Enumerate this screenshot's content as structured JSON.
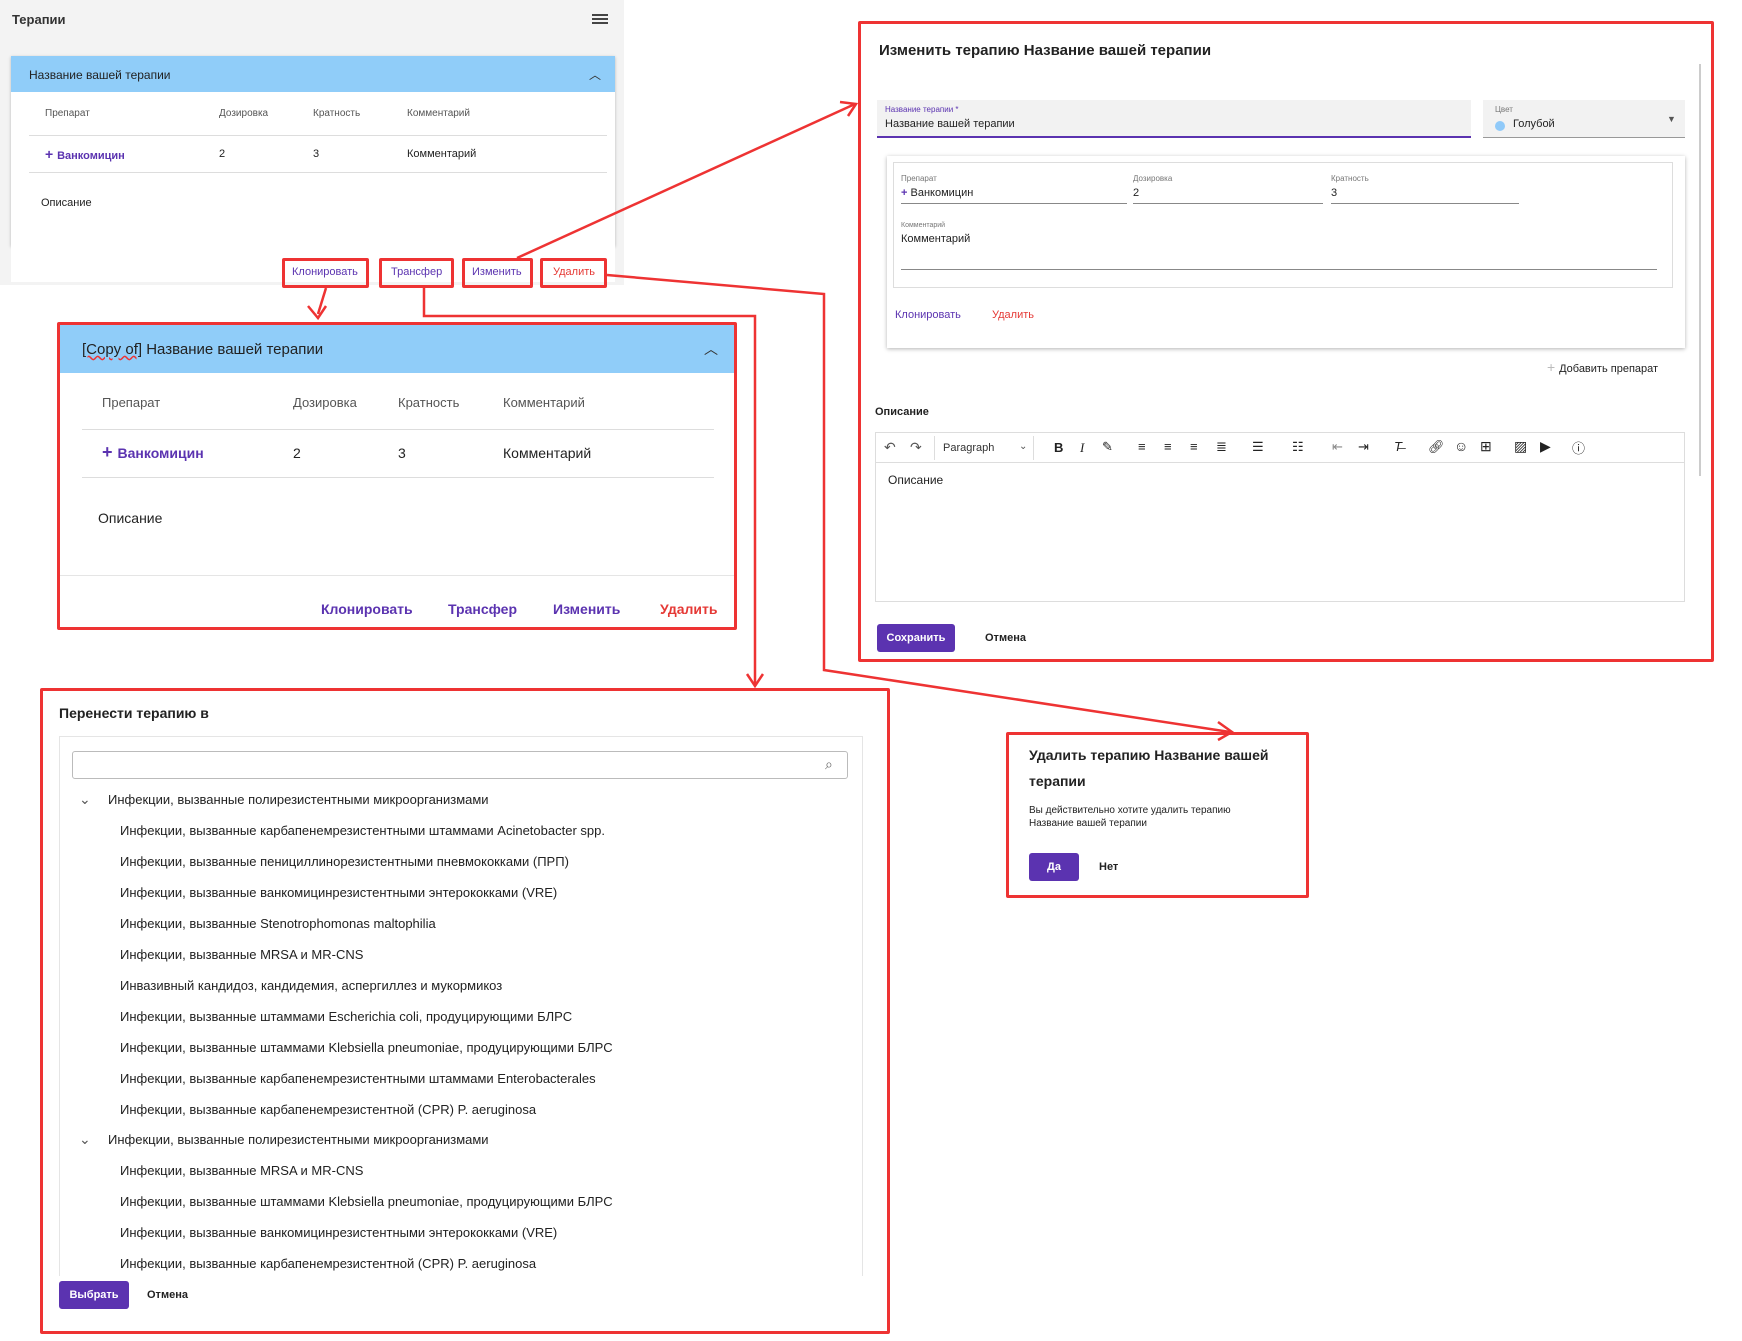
{
  "panel": {
    "title": "Терапии",
    "card_title": "Название вашей терапии",
    "columns": [
      "Препарат",
      "Дозировка",
      "Кратность",
      "Комментарий"
    ],
    "row": {
      "drug": "Ванкомицин",
      "dosage": "2",
      "frequency": "3",
      "comment": "Комментарий"
    },
    "description": "Описание",
    "actions": {
      "clone": "Клонировать",
      "transfer": "Трансфер",
      "edit": "Изменить",
      "delete": "Удалить"
    }
  },
  "clone_card": {
    "prefix": "[Copy of]",
    "title": "Название вашей терапии",
    "columns": [
      "Препарат",
      "Дозировка",
      "Кратность",
      "Комментарий"
    ],
    "row": {
      "drug": "Ванкомицин",
      "dosage": "2",
      "frequency": "3",
      "comment": "Комментарий"
    },
    "description": "Описание",
    "actions": {
      "clone": "Клонировать",
      "transfer": "Трансфер",
      "edit": "Изменить",
      "delete": "Удалить"
    }
  },
  "edit_dialog": {
    "title": "Изменить терапию Название вашей терапии",
    "name_label": "Название терапии *",
    "name_value": "Название вашей терапии",
    "color_label": "Цвет",
    "color_value": "Голубой",
    "color_swatch": "#90caf9",
    "drug_label": "Препарат",
    "drug_value": "Ванкомицин",
    "dosage_label": "Дозировка",
    "dosage_value": "2",
    "freq_label": "Кратность",
    "freq_value": "3",
    "comment_label": "Комментарий",
    "comment_value": "Комментарий",
    "clone": "Клонировать",
    "delete": "Удалить",
    "add_drug": "Добавить препарат",
    "description_label": "Описание",
    "editor_format": "Paragraph",
    "editor_text": "Описание",
    "save": "Сохранить",
    "cancel": "Отмена"
  },
  "transfer_dialog": {
    "title": "Перенести терапию в",
    "search_placeholder": "",
    "groups": [
      {
        "label": "Инфекции, вызванные полирезистентными микроорганизмами",
        "items": [
          "Инфекции, вызванные карбапенемрезистентными штаммами Acinetobacter spp.",
          "Инфекции, вызванные пенициллинорезистентными пневмококками (ПРП)",
          "Инфекции, вызванные ванкомицинрезистентными энтерококками (VRE)",
          "Инфекции, вызванные Stenotrophomonas maltophilia",
          "Инфекции, вызванные MRSA и MR-CNS",
          "Инвазивный кандидоз, кандидемия, аспергиллез и мукормикоз",
          "Инфекции, вызванные штаммами Escherichia coli, продуцирующими БЛРС",
          "Инфекции, вызванные штаммами Klebsiella pneumoniae, продуцирующими БЛРС",
          "Инфекции, вызванные карбапенемрезистентными штаммами Enterobacterales",
          "Инфекции, вызванные карбапенемрезистентной (CPR) P. aeruginosa"
        ]
      },
      {
        "label": "Инфекции, вызванные полирезистентными микроорганизмами",
        "items": [
          "Инфекции, вызванные MRSA и MR-CNS",
          "Инфекции, вызванные штаммами Klebsiella pneumoniae, продуцирующими БЛРС",
          "Инфекции, вызванные ванкомицинрезистентными энтерококками (VRE)",
          "Инфекции, вызванные карбапенемрезистентной (CPR) P. aeruginosa"
        ]
      }
    ],
    "select": "Выбрать",
    "cancel": "Отмена"
  },
  "delete_dialog": {
    "title_line1": "Удалить терапию Название вашей",
    "title_line2": "терапии",
    "text_line1": "Вы действительно хотите удалить терапию",
    "text_line2": "Название вашей терапии",
    "yes": "Да",
    "no": "Нет"
  },
  "colors": {
    "accent": "#5b33b0",
    "danger": "#e53935",
    "card_header": "#90cdf9",
    "annotation": "#ee3333"
  }
}
